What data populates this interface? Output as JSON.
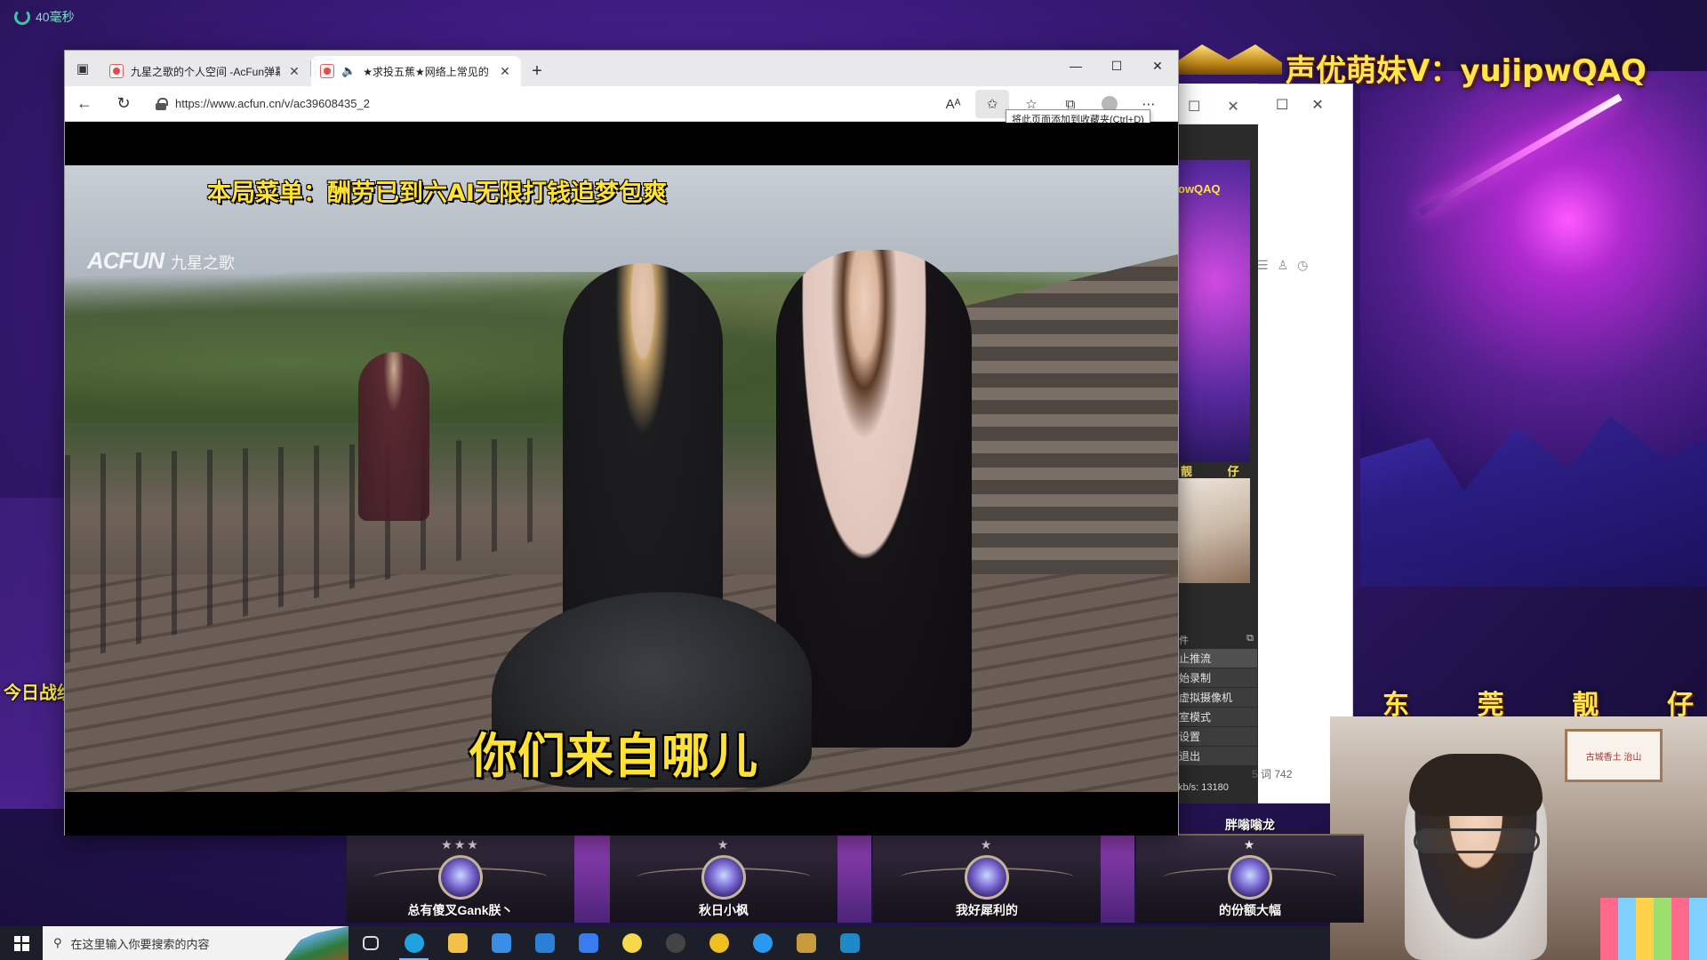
{
  "overlay": {
    "ping": "40毫秒",
    "streamer_title": "声优萌妹V：yujipwQAQ",
    "streamer_name_chars": [
      "东",
      "莞",
      "靓",
      "仔"
    ],
    "today_record": "今日战绩："
  },
  "background_window": {
    "preview_text": "owQAQ",
    "preview_text2": "靓 仔",
    "menu_head": "件",
    "menu_items": [
      "止推流",
      "始录制",
      "虚拟摄像机",
      "室模式",
      "设置",
      "退出"
    ],
    "status": "kb/s: 13180",
    "word_count": "5 词    742"
  },
  "webcam": {
    "frame_text": "古城香土 治山"
  },
  "players": [
    {
      "top": "",
      "stars": "★★★",
      "name": "总有傻叉Gank朕丶"
    },
    {
      "top": "",
      "stars": "★",
      "name": "秋日小枫"
    },
    {
      "top": "",
      "stars": "★",
      "name": "我好犀利的"
    },
    {
      "top": "胖嗡嗡龙",
      "stars": "★",
      "name": "的份额大幅"
    }
  ],
  "browser": {
    "tabs": [
      {
        "label": "九星之歌的个人空间 -AcFun弹幕",
        "active": false,
        "audio": false
      },
      {
        "label": "★求投五蕉★网络上常见的",
        "active": true,
        "audio": true
      }
    ],
    "url": "https://www.acfun.cn/v/ac39608435_2",
    "tooltip": "将此页面添加到收藏夹(Ctrl+D)",
    "video": {
      "menu_text": "本局菜单：酬劳已到六AI无限打钱追梦包爽",
      "logo": "ACFUN",
      "logo_sub": "九星之歌",
      "subtitle": "你们来自哪儿"
    }
  },
  "taskbar": {
    "search_placeholder": "在这里输入你要搜索的内容",
    "apps": [
      {
        "icon": "task-view-icon",
        "color": "#1c1f2a"
      },
      {
        "icon": "edge-icon",
        "color": "#1fa3e0"
      },
      {
        "icon": "file-explorer-icon",
        "color": "#f3c04a"
      },
      {
        "icon": "store-icon",
        "color": "#3a8ee6"
      },
      {
        "icon": "mail-icon",
        "color": "#2a7fd6"
      },
      {
        "icon": "feishu-icon",
        "color": "#3a7bf0"
      },
      {
        "icon": "obs-icon",
        "color": "#f5d94a"
      },
      {
        "icon": "record-icon",
        "color": "#444444"
      },
      {
        "icon": "app-icon-yellow",
        "color": "#f0c020"
      },
      {
        "icon": "search-app-icon",
        "color": "#2a9af0"
      },
      {
        "icon": "lol-client-icon",
        "color": "#c89b3c"
      },
      {
        "icon": "lol-game-icon",
        "color": "#1e88c8"
      }
    ]
  }
}
